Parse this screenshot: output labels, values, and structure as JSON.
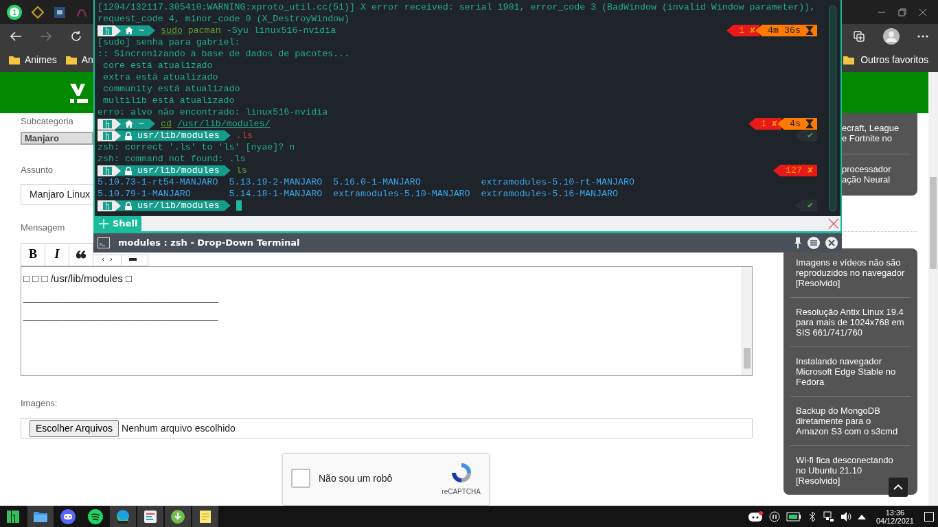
{
  "browser": {
    "tab_strip": {
      "notification_badge": "1"
    },
    "bookmarks": [
      {
        "label": "Animes"
      },
      {
        "label": "An"
      }
    ],
    "other_bookmarks": "Outros favoritos"
  },
  "form": {
    "subcategory_label": "Subcategoria",
    "subcategory_value": "Manjaro",
    "subject_label": "Assunto",
    "subject_value": "Manjaro Linux",
    "message_label": "Mensagem",
    "toolbar": [
      {
        "kind": "bold",
        "label": "B"
      },
      {
        "kind": "italic",
        "label": "I"
      },
      {
        "kind": "quote"
      },
      {
        "kind": "code"
      },
      {
        "kind": "video"
      }
    ],
    "message_lines": [
      "□ □ □ /usr/lib/modules □",
      "__________________________________",
      "__________________________________"
    ],
    "images_label": "Imagens:",
    "file_button": "Escolher Arquivos",
    "file_status": "Nenhum arquivo escolhido",
    "captcha": {
      "label": "Não sou um robô",
      "brand": "reCAPTCHA",
      "checked": false
    }
  },
  "sidebar": {
    "partial_items": [
      {
        "lines": [
          "ecraft, League",
          "e Fortnite no"
        ]
      },
      {
        "lines": [
          "processador",
          "ação Neural"
        ]
      }
    ],
    "items": [
      "Imagens e vídeos não são reproduzidos no navegador [Resolvido]",
      "Resolução Antix Linux 19.4 para mais de 1024x768 em SIS 661/741/760",
      "Instalando navegador Microsoft Edge Stable no Fedora",
      "Backup do MongoDB diretamente para o Amazon S3 com o s3cmd",
      "Wi-fi fica desconectando no Ubuntu 21.10 [Resolvido]"
    ]
  },
  "terminal": {
    "lines": [
      {
        "kind": "text",
        "text": "[1204/132117.305410:WARNING:xproto_util.cc(51)] X error received: serial 1901, error_code 3 (BadWindow (invalid Window parameter)),"
      },
      {
        "kind": "text",
        "text": "request_code 4, minor_code 0 (X_DestroyWindow)"
      },
      {
        "kind": "home_prompt",
        "path": "~",
        "command": [
          {
            "text": "sudo",
            "kind": "builtin"
          },
          {
            "text": "pacman",
            "kind": "command"
          },
          {
            "text": "-Syu linux516-nvidia",
            "kind": "arg"
          }
        ],
        "status": [
          {
            "kind": "error",
            "text": "1 ✘"
          },
          {
            "kind": "duration",
            "text": "4m 36s"
          }
        ]
      },
      {
        "kind": "text",
        "text": "[sudo] senha para gabriel:"
      },
      {
        "kind": "text",
        "text": ":: Sincronizando a base de dados de pacotes..."
      },
      {
        "kind": "text",
        "text": " core está atualizado"
      },
      {
        "kind": "text",
        "text": " extra está atualizado"
      },
      {
        "kind": "text",
        "text": " community está atualizado"
      },
      {
        "kind": "text",
        "text": " multilib está atualizado"
      },
      {
        "kind": "text",
        "text": "erro: alvo não encontrado: linux516-nvidia"
      },
      {
        "kind": "home_prompt",
        "path": "~",
        "command": [
          {
            "text": "cd",
            "kind": "builtin"
          },
          {
            "text": "/usr/lib/modules/",
            "kind": "path"
          }
        ],
        "status": [
          {
            "kind": "error",
            "text": "1 ✘"
          },
          {
            "kind": "duration",
            "text": "4s"
          }
        ]
      },
      {
        "kind": "locked_prompt",
        "path": "usr/lib/modules",
        "command": [
          {
            "text": ".ls",
            "kind": "error"
          }
        ],
        "status": [
          {
            "kind": "ok",
            "text": "✔"
          }
        ]
      },
      {
        "kind": "text",
        "text": "zsh: correct '.ls' to 'ls' [nyae]? n"
      },
      {
        "kind": "text",
        "text": "zsh: command not found: .ls"
      },
      {
        "kind": "locked_prompt",
        "path": "usr/lib/modules",
        "command": [
          {
            "text": "ls",
            "kind": "command"
          }
        ],
        "status": [
          {
            "kind": "error",
            "text": "127 ✘"
          }
        ]
      },
      {
        "kind": "listing",
        "cells": [
          "5.10.73-1-rt54-MANJARO",
          "5.13.19-2-MANJARO",
          "5.16.0-1-MANJARO",
          "extramodules-5.10-rt-MANJARO"
        ]
      },
      {
        "kind": "listing",
        "cells": [
          "5.10.79-1-MANJARO",
          "5.14.18-1-MANJARO",
          "extramodules-5.10-MANJARO",
          "extramodules-5.16-MANJARO"
        ]
      },
      {
        "kind": "locked_prompt",
        "path": "usr/lib/modules",
        "cursor": true,
        "status": [
          {
            "kind": "ok",
            "text": "✔"
          }
        ]
      }
    ],
    "tabs": [
      {
        "label": "Shell",
        "selected": true
      }
    ],
    "title": "modules : zsh - Drop-Down Terminal"
  },
  "taskbar": {
    "apps": [
      {
        "kind": "manjaro",
        "running": false
      },
      {
        "kind": "files",
        "running": true
      },
      {
        "kind": "discord",
        "running": false
      },
      {
        "kind": "spotify",
        "running": false
      },
      {
        "kind": "edge",
        "running": true
      },
      {
        "kind": "tasks",
        "running": true
      },
      {
        "kind": "download",
        "running": true
      },
      {
        "kind": "notes",
        "running": true
      }
    ],
    "time": "13:36",
    "date": "04/12/2021"
  }
}
